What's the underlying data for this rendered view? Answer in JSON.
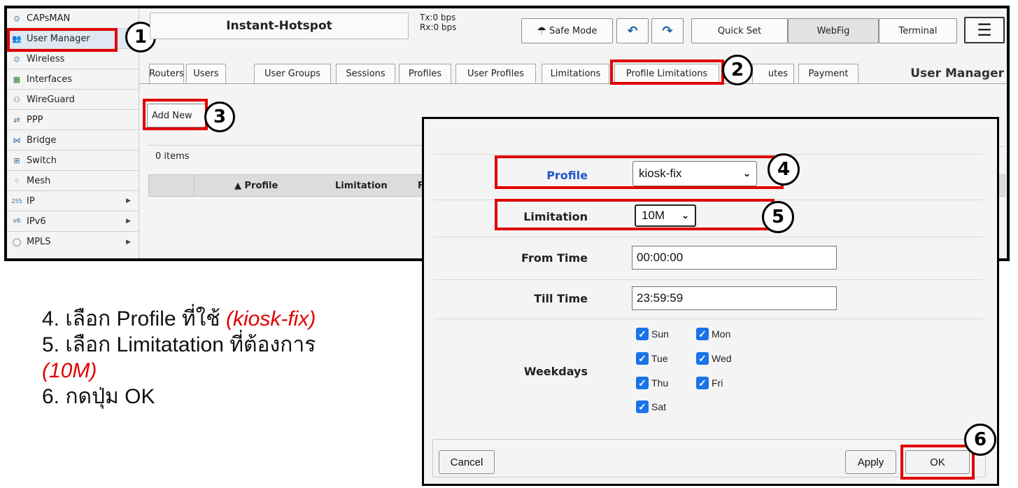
{
  "sidebar": {
    "items": [
      {
        "label": "CAPsMAN",
        "icon": "capsman-icon"
      },
      {
        "label": "User Manager",
        "icon": "users-icon"
      },
      {
        "label": "Wireless",
        "icon": "wireless-icon"
      },
      {
        "label": "Interfaces",
        "icon": "interfaces-icon"
      },
      {
        "label": "WireGuard",
        "icon": "wireguard-icon"
      },
      {
        "label": "PPP",
        "icon": "ppp-icon"
      },
      {
        "label": "Bridge",
        "icon": "bridge-icon"
      },
      {
        "label": "Switch",
        "icon": "switch-icon"
      },
      {
        "label": "Mesh",
        "icon": "mesh-icon"
      },
      {
        "label": "IP",
        "icon": "ip-icon"
      },
      {
        "label": "IPv6",
        "icon": "ipv6-icon"
      },
      {
        "label": "MPLS",
        "icon": "mpls-icon"
      }
    ]
  },
  "header": {
    "device_name": "Instant-Hotspot",
    "tx": "Tx:0 bps",
    "rx": "Rx:0 bps",
    "safe_mode": "Safe Mode",
    "quick_set": "Quick Set",
    "webfig": "WebFig",
    "terminal": "Terminal"
  },
  "tabs": [
    "Routers",
    "Users",
    "User Groups",
    "Sessions",
    "Profiles",
    "User Profiles",
    "Limitations",
    "Profile Limitations",
    "Attributes",
    "Payment"
  ],
  "tab_visible_partial": "utes",
  "section_title": "User Manager",
  "content": {
    "add_new": "Add New",
    "items_count": "0 items",
    "columns": [
      "▲ Profile",
      "Limitation",
      "F"
    ]
  },
  "dialog": {
    "profile_label": "Profile",
    "profile_value": "kiosk-fix",
    "limitation_label": "Limitation",
    "limitation_value": "10M",
    "from_time_label": "From Time",
    "from_time_value": "00:00:00",
    "till_time_label": "Till Time",
    "till_time_value": "23:59:59",
    "weekdays_label": "Weekdays",
    "days": [
      {
        "label": "Sun",
        "checked": true
      },
      {
        "label": "Mon",
        "checked": true
      },
      {
        "label": "Tue",
        "checked": true
      },
      {
        "label": "Wed",
        "checked": true
      },
      {
        "label": "Thu",
        "checked": true
      },
      {
        "label": "Fri",
        "checked": true
      },
      {
        "label": "Sat",
        "checked": true
      }
    ],
    "cancel": "Cancel",
    "apply": "Apply",
    "ok": "OK"
  },
  "steps": [
    "1",
    "2",
    "3",
    "4",
    "5",
    "6"
  ],
  "instructions": {
    "line1_prefix": "4. เลือก Profile ที่ใช้ ",
    "line1_highlight": "(kiosk-fix)",
    "line2": "5. เลือก Limitatation ที่ต้องการ",
    "line3_highlight": "(10M)",
    "line4": "6. กดปุ่ม OK"
  },
  "colors": {
    "highlight": "#e00000",
    "checkbox": "#1a73e8",
    "profile_label": "#2255cc"
  }
}
